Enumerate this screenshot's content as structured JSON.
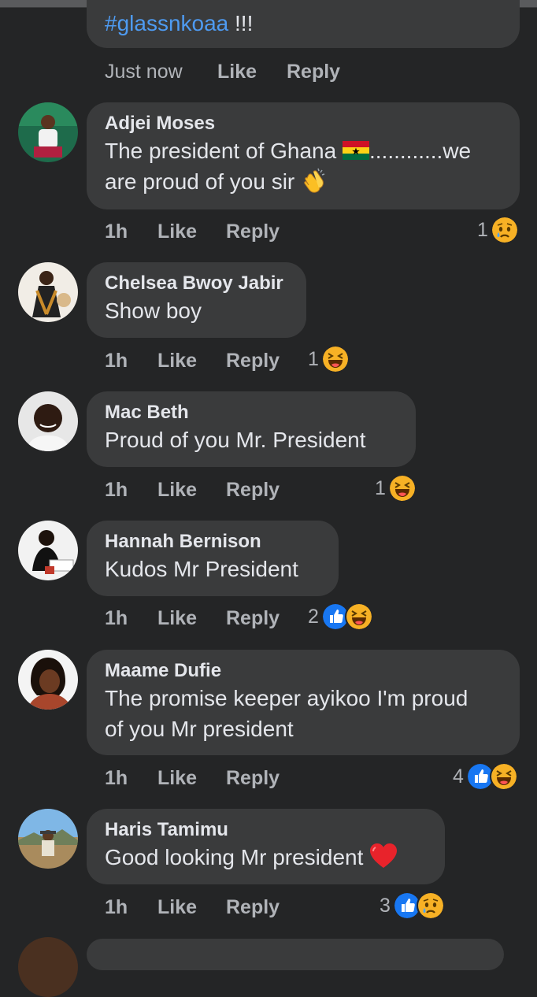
{
  "first_comment": {
    "text_tail": "#glassnkoaa",
    "text_suffix": " !!!",
    "time": "Just now",
    "like_label": "Like",
    "reply_label": "Reply"
  },
  "comments": [
    {
      "author": "Adjei Moses",
      "text_line1_before": "The president of Ghana ",
      "text_line1_after": "............we",
      "text_line2": "are proud of you sir ",
      "time": "1h",
      "like_label": "Like",
      "reply_label": "Reply",
      "reaction_count": "1",
      "reactions": [
        "sad-icon"
      ]
    },
    {
      "author": "Chelsea Bwoy Jabir",
      "text": "Show boy",
      "time": "1h",
      "like_label": "Like",
      "reply_label": "Reply",
      "reaction_count": "1",
      "reactions": [
        "haha-icon"
      ]
    },
    {
      "author": "Mac Beth",
      "text": "Proud of you Mr. President",
      "time": "1h",
      "like_label": "Like",
      "reply_label": "Reply",
      "reaction_count": "1",
      "reactions": [
        "haha-icon"
      ]
    },
    {
      "author": "Hannah Bernison",
      "text": "Kudos Mr President",
      "time": "1h",
      "like_label": "Like",
      "reply_label": "Reply",
      "reaction_count": "2",
      "reactions": [
        "like-icon",
        "haha-icon"
      ]
    },
    {
      "author": "Maame Dufie",
      "text_line1": "The promise keeper ayikoo I'm proud",
      "text_line2": "of you Mr president",
      "time": "1h",
      "like_label": "Like",
      "reply_label": "Reply",
      "reaction_count": "4",
      "reactions": [
        "like-icon",
        "haha-icon"
      ]
    },
    {
      "author": "Haris Tamimu",
      "text": "Good looking Mr president ",
      "time": "1h",
      "like_label": "Like",
      "reply_label": "Reply",
      "reaction_count": "3",
      "reactions": [
        "like-icon",
        "sad-icon"
      ]
    }
  ],
  "colors": {
    "background": "#242526",
    "bubble": "#3a3b3c",
    "primary_text": "#e4e6eb",
    "secondary_text": "#b0b3b8",
    "hashtag": "#4e9bf2",
    "like_blue": "#1877f2",
    "emoji_yellow": "#f7b125"
  }
}
